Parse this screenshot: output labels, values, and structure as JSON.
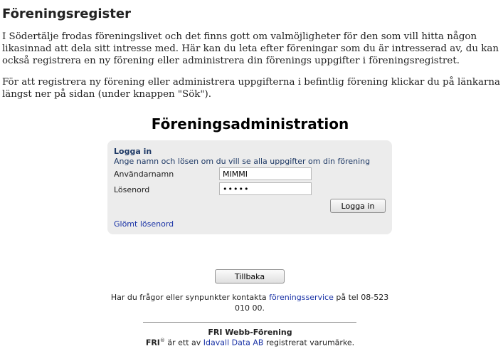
{
  "page": {
    "title": "Föreningsregister",
    "intro_1": "I Södertälje frodas föreningslivet och det finns gott om valmöjligheter för den som vill hitta någon likasinnad att dela sitt intresse med. Här kan du leta efter föreningar som du är intresserad av, du kan också registrera en ny förening eller administrera din förenings uppgifter i föreningsregistret.",
    "intro_2": "För att registrera ny förening eller administrera uppgifterna i befintlig förening klickar du på länkarna längst ner på sidan (under knappen \"Sök\")."
  },
  "admin": {
    "title": "Föreningsadministration"
  },
  "login": {
    "heading": "Logga in",
    "description": "Ange namn och lösen om du vill se alla uppgifter om din förening",
    "username_label": "Användarnamn",
    "username_value": "MIMMI",
    "password_label": "Lösenord",
    "password_value": "•••••",
    "login_button": "Logga in",
    "forgot_link": "Glömt lösenord"
  },
  "back_button": "Tillbaka",
  "contact": {
    "text_before": "Har du frågor eller synpunkter kontakta ",
    "link": "föreningsservice",
    "text_after": " på tel 08-523 010 00."
  },
  "footer": {
    "product_name": "FRI Webb-Förening",
    "brand": "FRI",
    "trademark_symbol": "®",
    "text_before": " är ett av ",
    "company_link": "Idavall Data AB",
    "text_after": " registrerat varumärke."
  }
}
